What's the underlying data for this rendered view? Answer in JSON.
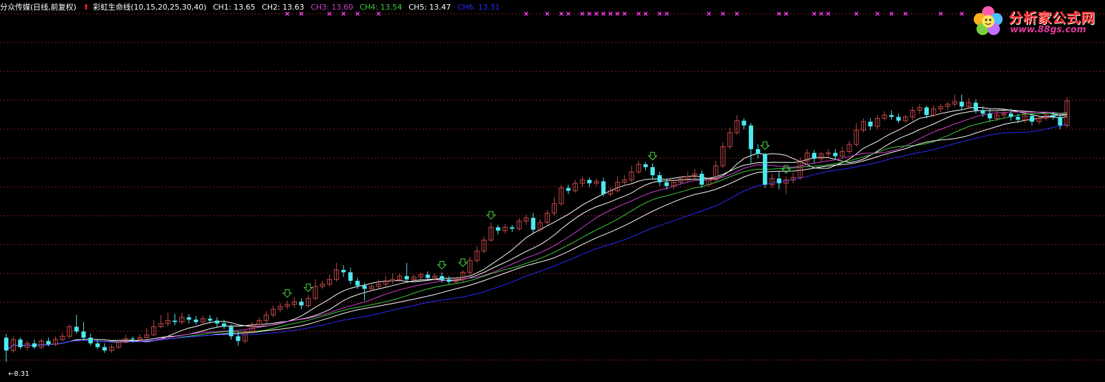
{
  "header": {
    "stock": "分众传媒(日线,前复权)",
    "indicator": "彩虹生命线(10,15,20,25,30,40)",
    "lines": [
      {
        "label": "CH1: 13.65",
        "color": "#ffffff"
      },
      {
        "label": "CH2: 13.63",
        "color": "#ffffff"
      },
      {
        "label": "CH3: 13.60",
        "color": "#d040d0"
      },
      {
        "label": "CH4: 13.54",
        "color": "#40d040"
      },
      {
        "label": "CH5: 13.47",
        "color": "#ffffff"
      },
      {
        "label": "CH6: 13.31",
        "color": "#2a2aff"
      }
    ]
  },
  "low_label": "8.31",
  "logo": {
    "title": "分析家公式网",
    "url": "www.88gs.com"
  },
  "colors": {
    "up": "#c04848",
    "down": "#4de8f0",
    "grid": "#8a1c1c",
    "cross_marker": "#ff40ff",
    "down_arrow": "#40e040"
  },
  "chart_data": {
    "type": "candlestick",
    "ylim": [
      8.0,
      15.6
    ],
    "grid": true,
    "candles": [
      [
        8.82,
        8.55,
        8.9,
        8.31
      ],
      [
        8.55,
        8.78,
        8.85,
        8.5
      ],
      [
        8.78,
        8.62,
        8.82,
        8.58
      ],
      [
        8.62,
        8.7,
        8.76,
        8.55
      ],
      [
        8.7,
        8.62,
        8.78,
        8.58
      ],
      [
        8.62,
        8.75,
        8.8,
        8.58
      ],
      [
        8.75,
        8.68,
        8.82,
        8.64
      ],
      [
        8.68,
        8.78,
        8.85,
        8.64
      ],
      [
        8.78,
        8.85,
        8.92,
        8.74
      ],
      [
        8.85,
        9.05,
        9.1,
        8.8
      ],
      [
        9.05,
        8.95,
        9.3,
        8.9
      ],
      [
        8.95,
        8.82,
        9.15,
        8.78
      ],
      [
        8.82,
        8.7,
        8.9,
        8.65
      ],
      [
        8.7,
        8.62,
        8.78,
        8.58
      ],
      [
        8.62,
        8.55,
        8.7,
        8.5
      ],
      [
        8.55,
        8.62,
        8.68,
        8.5
      ],
      [
        8.62,
        8.72,
        8.78,
        8.58
      ],
      [
        8.72,
        8.8,
        8.88,
        8.7
      ],
      [
        8.8,
        8.78,
        8.84,
        8.72
      ],
      [
        8.78,
        8.82,
        8.9,
        8.74
      ],
      [
        8.82,
        8.88,
        9.02,
        8.8
      ],
      [
        8.88,
        9.05,
        9.2,
        8.85
      ],
      [
        9.05,
        9.12,
        9.3,
        9.02
      ],
      [
        9.12,
        9.18,
        9.35,
        9.06
      ],
      [
        9.18,
        9.15,
        9.32,
        9.08
      ],
      [
        9.15,
        9.25,
        9.35,
        9.1
      ],
      [
        9.25,
        9.2,
        9.32,
        9.12
      ],
      [
        9.2,
        9.15,
        9.28,
        9.1
      ],
      [
        9.15,
        9.22,
        9.28,
        9.1
      ],
      [
        9.22,
        9.18,
        9.3,
        9.12
      ],
      [
        9.18,
        9.12,
        9.25,
        9.05
      ],
      [
        9.12,
        9.05,
        9.2,
        9.0
      ],
      [
        9.05,
        8.85,
        9.1,
        8.78
      ],
      [
        8.85,
        8.75,
        8.95,
        8.65
      ],
      [
        8.75,
        8.95,
        9.0,
        8.7
      ],
      [
        8.95,
        9.1,
        9.15,
        8.9
      ],
      [
        9.1,
        9.18,
        9.25,
        9.05
      ],
      [
        9.18,
        9.3,
        9.38,
        9.12
      ],
      [
        9.3,
        9.42,
        9.5,
        9.25
      ],
      [
        9.42,
        9.48,
        9.55,
        9.35
      ],
      [
        9.48,
        9.52,
        9.6,
        9.42
      ],
      [
        9.52,
        9.58,
        9.68,
        9.45
      ],
      [
        9.58,
        9.5,
        9.65,
        9.42
      ],
      [
        9.5,
        9.65,
        9.72,
        9.45
      ],
      [
        9.65,
        9.9,
        10.05,
        9.6
      ],
      [
        9.9,
        9.95,
        10.02,
        9.85
      ],
      [
        9.95,
        10.05,
        10.15,
        9.9
      ],
      [
        10.05,
        10.25,
        10.4,
        10.0
      ],
      [
        10.25,
        10.2,
        10.35,
        10.1
      ],
      [
        10.2,
        10.02,
        10.3,
        9.95
      ],
      [
        10.02,
        9.92,
        10.08,
        9.85
      ],
      [
        9.92,
        9.85,
        9.98,
        9.6
      ],
      [
        9.85,
        9.9,
        9.95,
        9.8
      ],
      [
        9.9,
        9.95,
        10.05,
        9.85
      ],
      [
        9.95,
        10.02,
        10.12,
        9.9
      ],
      [
        10.02,
        10.05,
        10.18,
        9.95
      ],
      [
        10.05,
        10.12,
        10.18,
        10.0
      ],
      [
        10.12,
        10.05,
        10.4,
        10.0
      ],
      [
        10.05,
        10.1,
        10.15,
        10.0
      ],
      [
        10.1,
        10.15,
        10.2,
        10.05
      ],
      [
        10.15,
        10.08,
        10.22,
        10.02
      ],
      [
        10.08,
        10.12,
        10.18,
        10.02
      ],
      [
        10.12,
        10.05,
        10.2,
        9.98
      ],
      [
        10.05,
        10.0,
        10.12,
        9.95
      ],
      [
        10.0,
        10.05,
        10.1,
        9.95
      ],
      [
        10.05,
        10.2,
        10.25,
        10.0
      ],
      [
        10.2,
        10.45,
        10.52,
        10.15
      ],
      [
        10.45,
        10.65,
        10.75,
        10.4
      ],
      [
        10.65,
        10.88,
        10.95,
        10.6
      ],
      [
        10.88,
        11.15,
        11.25,
        10.85
      ],
      [
        11.15,
        11.08,
        11.2,
        11.0
      ],
      [
        11.08,
        11.15,
        11.22,
        11.02
      ],
      [
        11.15,
        11.12,
        11.2,
        11.05
      ],
      [
        11.12,
        11.28,
        11.35,
        11.08
      ],
      [
        11.28,
        11.35,
        11.42,
        11.2
      ],
      [
        11.35,
        11.1,
        11.45,
        11.02
      ],
      [
        11.1,
        11.25,
        11.32,
        11.05
      ],
      [
        11.25,
        11.45,
        11.52,
        11.2
      ],
      [
        11.45,
        11.65,
        11.78,
        11.4
      ],
      [
        11.65,
        11.98,
        12.05,
        11.6
      ],
      [
        11.98,
        11.92,
        12.05,
        11.85
      ],
      [
        11.92,
        12.08,
        12.15,
        11.88
      ],
      [
        12.08,
        12.15,
        12.22,
        12.0
      ],
      [
        12.15,
        12.08,
        12.2,
        12.0
      ],
      [
        12.08,
        12.12,
        12.18,
        12.02
      ],
      [
        12.12,
        11.85,
        12.2,
        11.8
      ],
      [
        11.85,
        11.92,
        12.0,
        11.8
      ],
      [
        11.92,
        12.1,
        12.22,
        11.88
      ],
      [
        12.1,
        12.15,
        12.25,
        12.02
      ],
      [
        12.15,
        12.32,
        12.45,
        12.1
      ],
      [
        12.32,
        12.48,
        12.55,
        12.28
      ],
      [
        12.48,
        12.42,
        12.52,
        12.35
      ],
      [
        12.42,
        12.25,
        12.5,
        12.18
      ],
      [
        12.25,
        12.1,
        12.32,
        12.02
      ],
      [
        12.1,
        12.02,
        12.18,
        11.95
      ],
      [
        12.02,
        12.1,
        12.15,
        11.95
      ],
      [
        12.1,
        12.18,
        12.22,
        12.05
      ],
      [
        12.18,
        12.22,
        12.32,
        12.1
      ],
      [
        12.22,
        12.28,
        12.38,
        12.15
      ],
      [
        12.28,
        12.05,
        12.35,
        11.98
      ],
      [
        12.05,
        12.15,
        12.22,
        12.0
      ],
      [
        12.15,
        12.45,
        12.55,
        12.1
      ],
      [
        12.45,
        12.85,
        12.95,
        12.4
      ],
      [
        12.85,
        13.15,
        13.25,
        12.8
      ],
      [
        13.15,
        13.4,
        13.52,
        13.1
      ],
      [
        13.4,
        13.3,
        13.45,
        13.22
      ],
      [
        13.3,
        12.8,
        13.35,
        12.5
      ],
      [
        12.8,
        12.7,
        12.9,
        12.6
      ],
      [
        12.7,
        12.05,
        12.72,
        11.98
      ],
      [
        12.05,
        12.18,
        12.28,
        11.98
      ],
      [
        12.18,
        12.08,
        12.32,
        11.95
      ],
      [
        12.08,
        12.15,
        12.22,
        11.85
      ],
      [
        12.15,
        12.2,
        12.3,
        12.08
      ],
      [
        12.2,
        12.55,
        12.62,
        12.15
      ],
      [
        12.55,
        12.72,
        12.8,
        12.48
      ],
      [
        12.72,
        12.6,
        12.78,
        12.5
      ],
      [
        12.6,
        12.7,
        12.75,
        12.52
      ],
      [
        12.7,
        12.72,
        12.8,
        12.62
      ],
      [
        12.72,
        12.65,
        12.8,
        12.58
      ],
      [
        12.65,
        12.75,
        12.85,
        12.6
      ],
      [
        12.75,
        12.9,
        12.98,
        12.7
      ],
      [
        12.9,
        13.2,
        13.35,
        12.85
      ],
      [
        13.2,
        13.38,
        13.45,
        13.15
      ],
      [
        13.38,
        13.28,
        13.45,
        13.2
      ],
      [
        13.28,
        13.45,
        13.52,
        13.22
      ],
      [
        13.45,
        13.52,
        13.6,
        13.4
      ],
      [
        13.52,
        13.48,
        13.62,
        13.42
      ],
      [
        13.48,
        13.4,
        13.55,
        13.35
      ],
      [
        13.4,
        13.48,
        13.52,
        13.35
      ],
      [
        13.48,
        13.62,
        13.7,
        13.4
      ],
      [
        13.62,
        13.68,
        13.75,
        13.55
      ],
      [
        13.68,
        13.52,
        13.72,
        13.45
      ],
      [
        13.52,
        13.65,
        13.72,
        13.48
      ],
      [
        13.65,
        13.7,
        13.75,
        13.58
      ],
      [
        13.7,
        13.75,
        13.8,
        13.62
      ],
      [
        13.75,
        13.8,
        13.95,
        13.7
      ],
      [
        13.8,
        13.7,
        13.95,
        13.62
      ],
      [
        13.7,
        13.78,
        13.88,
        13.65
      ],
      [
        13.78,
        13.62,
        13.85,
        13.55
      ],
      [
        13.62,
        13.55,
        13.7,
        13.48
      ],
      [
        13.55,
        13.45,
        13.65,
        13.38
      ],
      [
        13.45,
        13.52,
        13.6,
        13.4
      ],
      [
        13.52,
        13.55,
        13.62,
        13.45
      ],
      [
        13.55,
        13.48,
        13.65,
        13.4
      ],
      [
        13.48,
        13.42,
        13.55,
        13.35
      ],
      [
        13.42,
        13.5,
        13.58,
        13.35
      ],
      [
        13.5,
        13.38,
        13.55,
        13.3
      ],
      [
        13.38,
        13.45,
        13.52,
        13.32
      ],
      [
        13.45,
        13.52,
        13.58,
        13.4
      ],
      [
        13.52,
        13.48,
        13.58,
        13.42
      ],
      [
        13.48,
        13.3,
        13.55,
        13.22
      ],
      [
        13.3,
        13.82,
        13.9,
        13.25
      ]
    ],
    "ma_periods": [
      10,
      15,
      20,
      25,
      30,
      40
    ],
    "ma_colors": [
      "#ffffff",
      "#ffffff",
      "#d040d0",
      "#40d040",
      "#ffffff",
      "#2a2aff"
    ],
    "latest_values": [
      13.65,
      13.63,
      13.6,
      13.54,
      13.47,
      13.31
    ],
    "down_arrow_days": [
      40,
      43,
      62,
      65,
      69,
      92,
      108,
      111
    ],
    "cross_marker_days": [
      40,
      42,
      46,
      48,
      50,
      53,
      74,
      77,
      79,
      80,
      82,
      83,
      84,
      85,
      86,
      87,
      88,
      90,
      91,
      93,
      94,
      100,
      102,
      104,
      110,
      111,
      115,
      116,
      117,
      121,
      124,
      126,
      128,
      133,
      136
    ],
    "low_marker": {
      "value": 8.31,
      "day": 0
    }
  }
}
